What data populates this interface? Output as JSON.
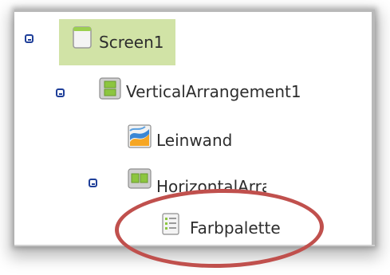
{
  "tree": {
    "nodes": [
      {
        "label": "Screen1",
        "icon": "screen-icon",
        "expanded": true,
        "selected": true
      },
      {
        "label": "VerticalArrangement1",
        "icon": "vertical-arrangement-icon",
        "expanded": true
      },
      {
        "label": "Leinwand",
        "icon": "canvas-icon"
      },
      {
        "label": "HorizontalArrangemen",
        "icon": "horizontal-arrangement-icon",
        "expanded": true
      },
      {
        "label": "Farbpalette",
        "icon": "listview-icon"
      }
    ]
  },
  "colors": {
    "selection": "#d1e3a6",
    "toggle": "#1f3f99",
    "highlight_oval": "#c0504d"
  }
}
